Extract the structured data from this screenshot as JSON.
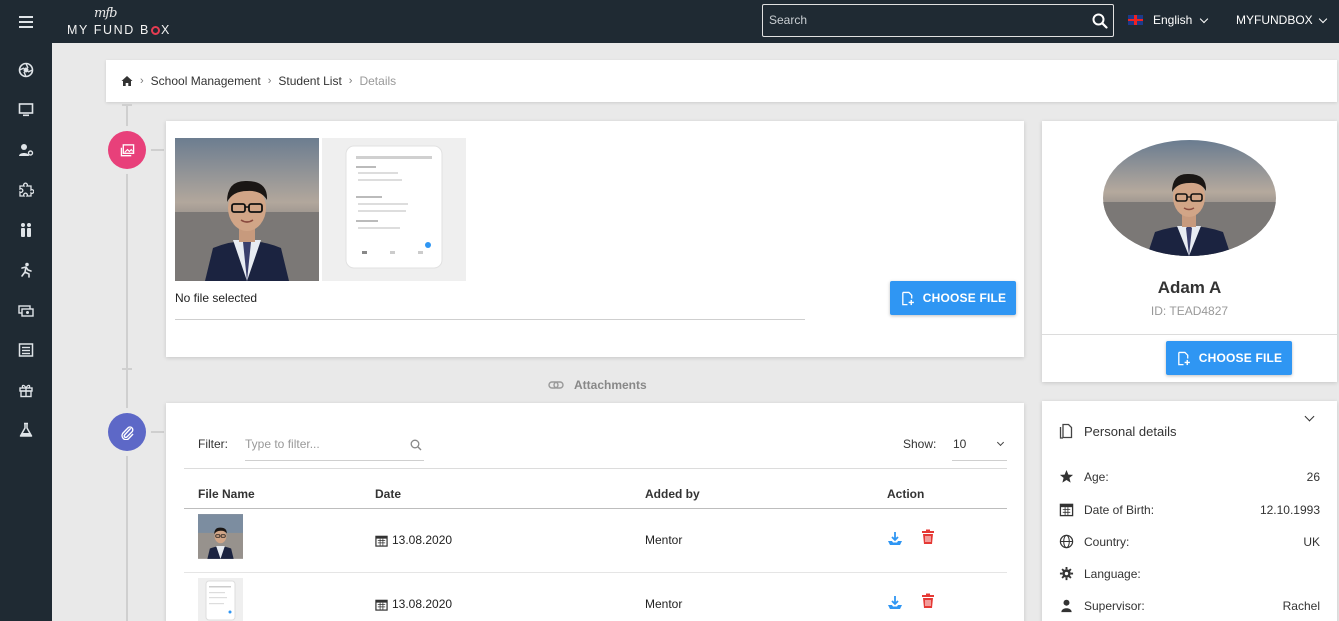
{
  "brand": {
    "signature": "mfb",
    "name_part1": "MY FUND B",
    "name_part2": "X"
  },
  "search": {
    "placeholder": "Search"
  },
  "language": {
    "label": "English"
  },
  "account": {
    "label": "MYFUNDBOX"
  },
  "breadcrumb": {
    "items": [
      "School Management",
      "Student List",
      "Details"
    ]
  },
  "upload": {
    "status": "No file selected",
    "button_label": "CHOOSE FILE"
  },
  "attachments": {
    "section_label": "Attachments",
    "filter_label": "Filter:",
    "filter_placeholder": "Type to filter...",
    "show_label": "Show:",
    "show_value": "10",
    "columns": [
      "File Name",
      "Date",
      "Added by",
      "Action"
    ],
    "rows": [
      {
        "date": "13.08.2020",
        "added_by": "Mentor"
      },
      {
        "date": "13.08.2020",
        "added_by": "Mentor"
      }
    ]
  },
  "profile": {
    "name": "Adam A",
    "id": "ID: TEAD4827",
    "button_label": "CHOOSE FILE"
  },
  "personal": {
    "title": "Personal details",
    "items": [
      {
        "label": "Age:",
        "value": "26",
        "icon": "star-icon"
      },
      {
        "label": "Date of Birth:",
        "value": "12.10.1993",
        "icon": "calendar-icon"
      },
      {
        "label": "Country:",
        "value": "UK",
        "icon": "globe-icon"
      },
      {
        "label": "Language:",
        "value": "",
        "icon": "gear-icon"
      },
      {
        "label": "Supervisor:",
        "value": "Rachel",
        "icon": "user-icon"
      }
    ]
  },
  "colors": {
    "topbar": "#1f2a33",
    "accent_blue": "#2f96f3",
    "timeline_pink": "#e8407a",
    "timeline_purple": "#5d68c7",
    "delete_red": "#e53935"
  }
}
